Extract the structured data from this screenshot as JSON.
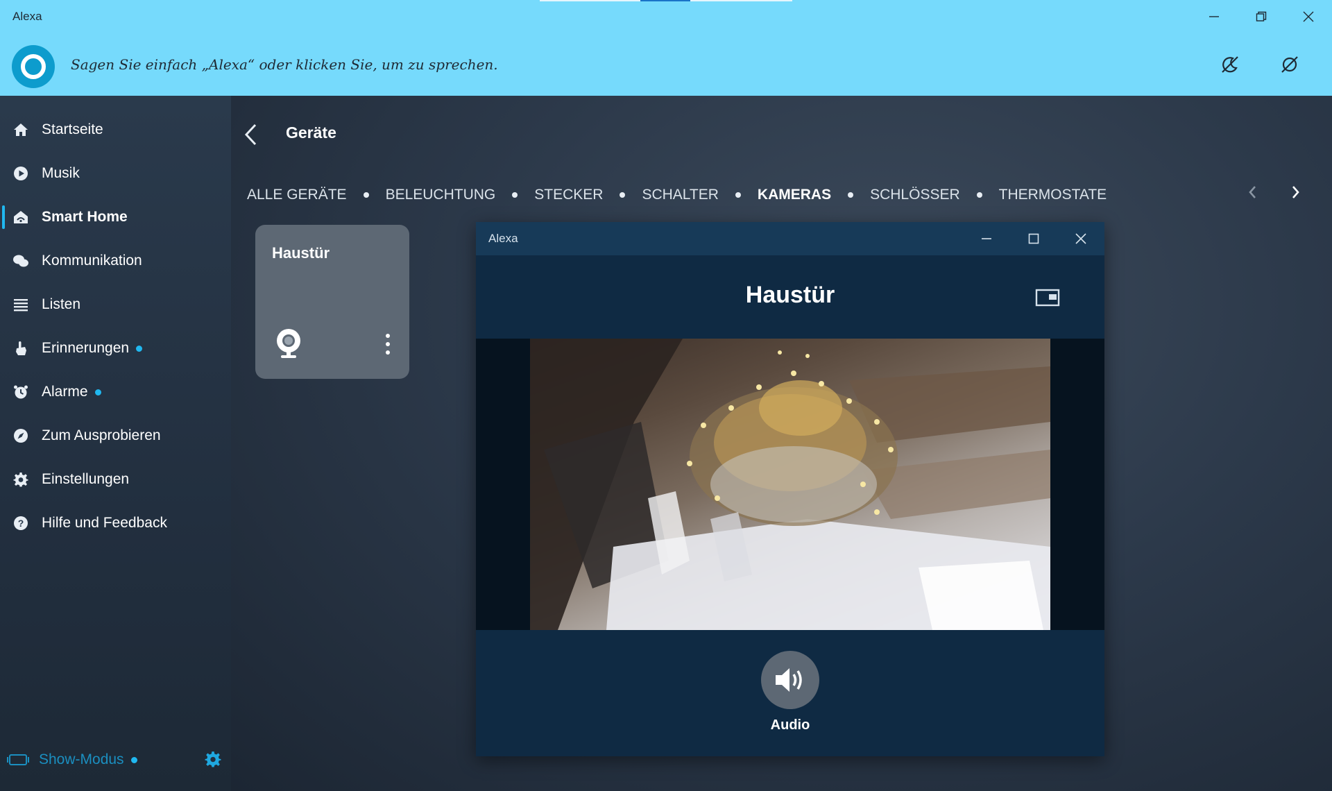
{
  "window": {
    "title": "Alexa",
    "minimize_icon": "minimize-icon",
    "restore_icon": "restore-icon",
    "close_icon": "close-icon"
  },
  "header": {
    "prompt": "Sagen Sie einfach „Alexa“ oder klicken Sie, um zu sprechen.",
    "logo_icon": "alexa-ring-icon",
    "do_not_disturb_icon": "moon-slash-icon",
    "mic_off_icon": "mic-off-icon"
  },
  "sidebar": {
    "items": [
      {
        "label": "Startseite",
        "icon": "home-icon",
        "active": false,
        "badge": false
      },
      {
        "label": "Musik",
        "icon": "play-icon",
        "active": false,
        "badge": false
      },
      {
        "label": "Smart Home",
        "icon": "smart-home-icon",
        "active": true,
        "badge": false
      },
      {
        "label": "Kommunikation",
        "icon": "chat-bubbles-icon",
        "active": false,
        "badge": false
      },
      {
        "label": "Listen",
        "icon": "list-icon",
        "active": false,
        "badge": false
      },
      {
        "label": "Erinnerungen",
        "icon": "reminder-hand-icon",
        "active": false,
        "badge": true
      },
      {
        "label": "Alarme",
        "icon": "alarm-clock-icon",
        "active": false,
        "badge": true
      },
      {
        "label": "Zum Ausprobieren",
        "icon": "compass-icon",
        "active": false,
        "badge": false
      },
      {
        "label": "Einstellungen",
        "icon": "gear-icon",
        "active": false,
        "badge": false
      },
      {
        "label": "Hilfe und Feedback",
        "icon": "help-icon",
        "active": false,
        "badge": false
      }
    ],
    "show_mode": {
      "label": "Show-Modus",
      "badge": true,
      "icon": "show-mode-icon",
      "settings_icon": "gear-icon"
    }
  },
  "page": {
    "title": "Geräte",
    "back_icon": "chevron-left-icon"
  },
  "tabs": [
    {
      "label": "ALLE GERÄTE",
      "active": false
    },
    {
      "label": "BELEUCHTUNG",
      "active": false
    },
    {
      "label": "STECKER",
      "active": false
    },
    {
      "label": "SCHALTER",
      "active": false
    },
    {
      "label": "KAMERAS",
      "active": true
    },
    {
      "label": "SCHLÖSSER",
      "active": false
    },
    {
      "label": "THERMOSTATE",
      "active": false
    }
  ],
  "tab_nav": {
    "prev_icon": "chevron-left-icon",
    "next_icon": "chevron-right-icon"
  },
  "device_card": {
    "title": "Haustür",
    "icon": "webcam-icon",
    "more_icon": "more-vertical-icon"
  },
  "popup": {
    "window_title": "Alexa",
    "heading": "Haustür",
    "pip_icon": "picture-in-picture-icon",
    "audio_label": "Audio",
    "audio_icon": "speaker-icon"
  },
  "colors": {
    "header_bg": "#76dafc",
    "accent": "#20b8f0",
    "sidebar_bg": "#2a3a4c",
    "popup_bg": "#0f2a43"
  }
}
